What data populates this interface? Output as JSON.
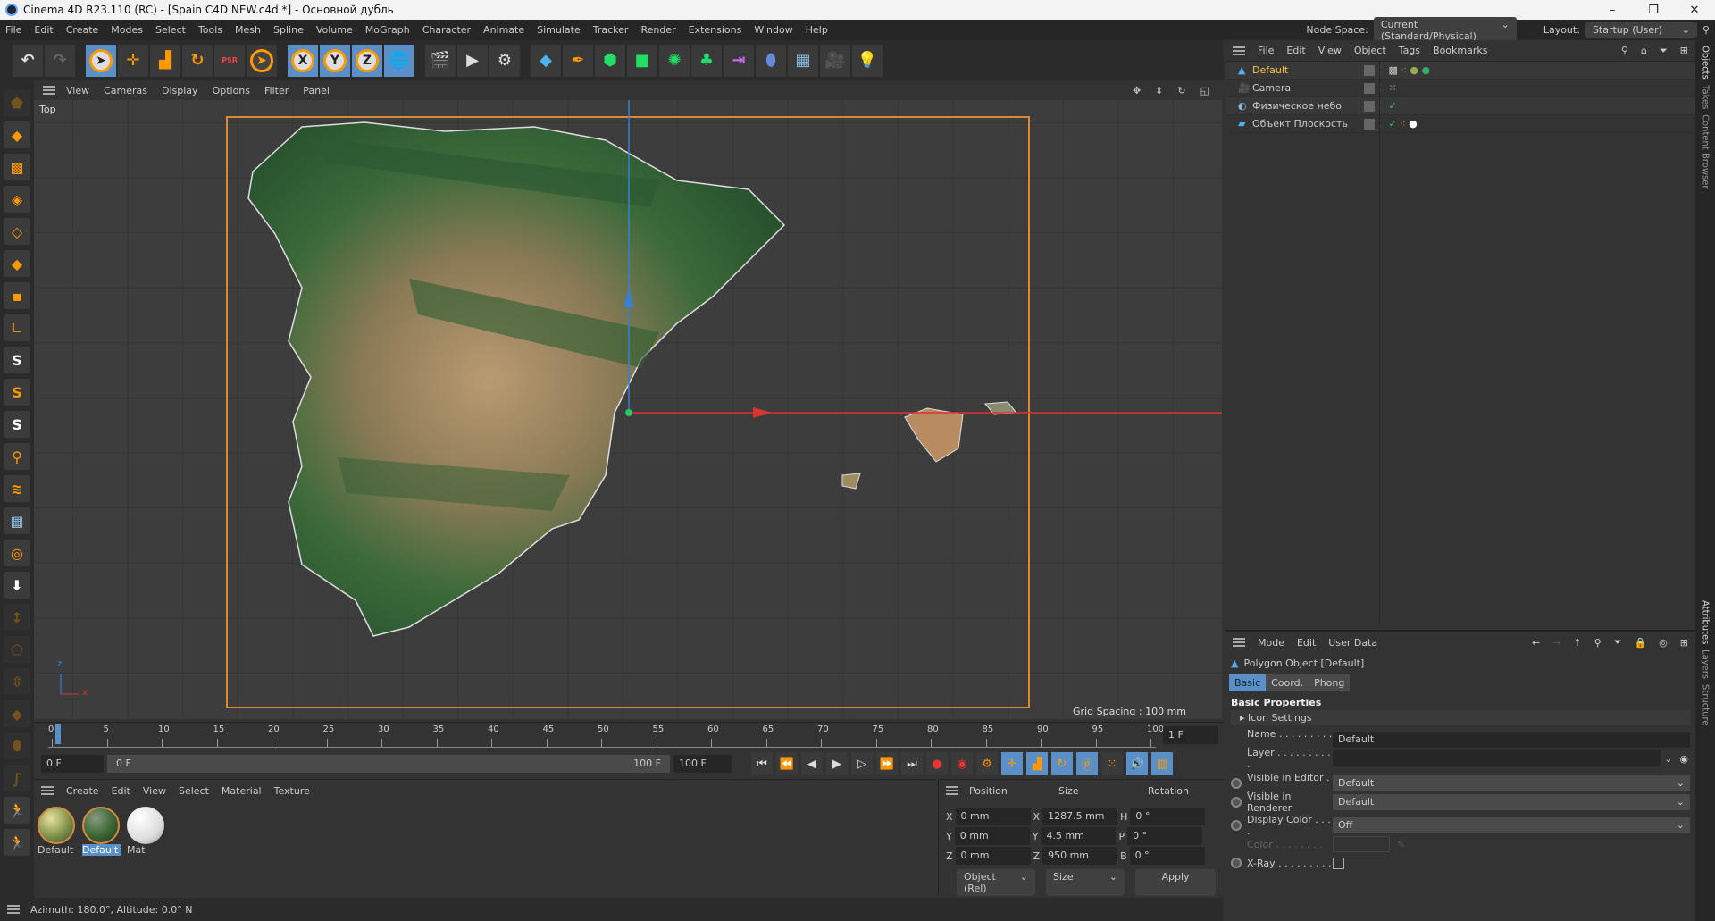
{
  "window": {
    "title": "Cinema 4D R23.110 (RC) - [Spain C4D NEW.c4d *] - Основной дубль",
    "controls": [
      "–",
      "❐",
      "✕"
    ]
  },
  "menu": [
    "File",
    "Edit",
    "Create",
    "Modes",
    "Select",
    "Tools",
    "Mesh",
    "Spline",
    "Volume",
    "MoGraph",
    "Character",
    "Animate",
    "Simulate",
    "Tracker",
    "Render",
    "Extensions",
    "Window",
    "Help"
  ],
  "node_space": {
    "label": "Node Space:",
    "value": "Current (Standard/Physical)"
  },
  "layout": {
    "label": "Layout:",
    "value": "Startup (User)"
  },
  "toolbar": {
    "axes": [
      "X",
      "Y",
      "Z"
    ],
    "psr": "PSR"
  },
  "viewport": {
    "menu": [
      "View",
      "Cameras",
      "Display",
      "Options",
      "Filter",
      "Panel"
    ],
    "view_name": "Top",
    "grid_spacing": "Grid Spacing : 100 mm",
    "axis_x": "x",
    "axis_z": "z"
  },
  "timeline": {
    "ticks": [
      "0",
      "5",
      "10",
      "15",
      "20",
      "25",
      "30",
      "35",
      "40",
      "45",
      "50",
      "55",
      "60",
      "65",
      "70",
      "75",
      "80",
      "85",
      "90",
      "95",
      "100"
    ],
    "current": "1 F",
    "start": "0 F",
    "range_start": "0 F",
    "range_end": "100 F",
    "end": "100 F"
  },
  "materials": {
    "menu": [
      "Create",
      "Edit",
      "View",
      "Select",
      "Material",
      "Texture"
    ],
    "items": [
      {
        "name": "Default",
        "color": "#8a9a50"
      },
      {
        "name": "Default",
        "color": "#3f6a3a",
        "selected": true
      },
      {
        "name": "Mat",
        "color": "#eeeeee"
      }
    ]
  },
  "coordinates": {
    "headers": [
      "Position",
      "Size",
      "Rotation"
    ],
    "rows": [
      {
        "axis": "X",
        "pos": "0 mm",
        "size_axis": "X",
        "size": "1287.5 mm",
        "rot_axis": "H",
        "rot": "0 °"
      },
      {
        "axis": "Y",
        "pos": "0 mm",
        "size_axis": "Y",
        "size": "4.5 mm",
        "rot_axis": "P",
        "rot": "0 °"
      },
      {
        "axis": "Z",
        "pos": "0 mm",
        "size_axis": "Z",
        "size": "950 mm",
        "rot_axis": "B",
        "rot": "0 °"
      }
    ],
    "mode": "Object (Rel)",
    "size_mode": "Size",
    "apply": "Apply"
  },
  "status": "Azimuth: 180.0°, Altitude: 0.0°  N",
  "objects": {
    "menu": [
      "File",
      "Edit",
      "View",
      "Object",
      "Tags",
      "Bookmarks"
    ],
    "items": [
      {
        "name": "Default",
        "active": true
      },
      {
        "name": "Camera"
      },
      {
        "name": "Физическое небо"
      },
      {
        "name": "Объект Плоскость"
      }
    ]
  },
  "attributes": {
    "menu": [
      "Mode",
      "Edit",
      "User Data"
    ],
    "object": "Polygon Object [Default]",
    "tabs": [
      "Basic",
      "Coord.",
      "Phong"
    ],
    "section": "Basic Properties",
    "group": "Icon Settings",
    "name_label": "Name . . . . . . . . . .",
    "name_value": "Default",
    "layer_label": "Layer . . . . . . . . . .",
    "visible_editor_label": "Visible in Editor . .",
    "visible_editor": "Default",
    "visible_renderer_label": "Visible in Renderer",
    "visible_renderer": "Default",
    "display_color_label": "Display Color . . . .",
    "display_color": "Off",
    "color_label": "Color . . . . . . . .",
    "xray_label": "X-Ray . . . . . . . . ."
  },
  "side_tabs": [
    "Objects",
    "Takes",
    "Content Browser",
    "Attributes",
    "Layers",
    "Structure"
  ],
  "colors": {
    "accent": "#5b8fc7",
    "orange": "#f0962b",
    "active_name": "#f5c542"
  }
}
